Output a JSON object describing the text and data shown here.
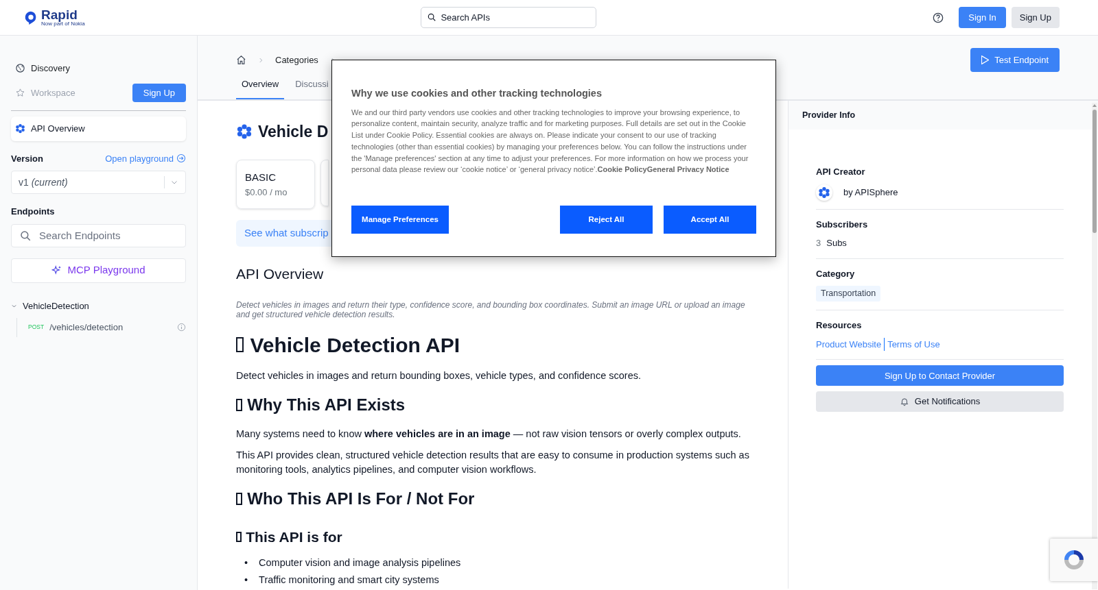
{
  "header": {
    "logo": "Rapid",
    "logo_tagline": "Now part of Nokia",
    "search": {
      "placeholder": "Search APIs"
    },
    "sign_in": "Sign In",
    "sign_up": "Sign Up"
  },
  "sidebar": {
    "nav": [
      {
        "label": "Discovery",
        "disabled": false
      },
      {
        "label": "Workspace",
        "disabled": true
      }
    ],
    "workspace_signup": "Sign Up",
    "api_overview": {
      "label": "API Overview",
      "selected": true
    },
    "version": {
      "label": "Version",
      "playground_link": "Open playground",
      "value": "v1",
      "note": "(current)"
    },
    "endpoints": {
      "label": "Endpoints",
      "search": {
        "placeholder": "Search Endpoints"
      },
      "mcp_button": "MCP Playground",
      "groups": [
        {
          "name": "VehicleDetection",
          "expanded": true,
          "children": [
            {
              "method": "POST",
              "path": "/vehicles/detection"
            }
          ]
        }
      ]
    }
  },
  "breadcrumb": [
    "Categories"
  ],
  "tabs": [
    {
      "label": "Overview",
      "selected": true
    },
    {
      "label": "Discussi",
      "selected": false
    }
  ],
  "test_endpoint": "Test Endpoint",
  "main": {
    "title": "Vehicle D",
    "plans": [
      {
        "name": "BASIC",
        "price": "$0.00 / mo"
      }
    ],
    "subscription_link": "See what subscrip",
    "overview_heading": "API Overview",
    "summary": "Detect vehicles in images and return their type, confidence score, and bounding box coordinates. Submit an image URL or upload an image and get structured vehicle detection results.",
    "blocks": [
      {
        "kind": "h1",
        "text": "Vehicle Detection API"
      },
      {
        "kind": "p",
        "text": "Detect vehicles in images and return bounding boxes, vehicle types, and confidence scores."
      },
      {
        "kind": "h2",
        "text": "Why This API Exists"
      },
      {
        "kind": "p",
        "text": "Many systems need to know **where vehicles are in an image** — not raw vision tensors or overly complex outputs."
      },
      {
        "kind": "p",
        "text": "This API provides clean, structured vehicle detection results that are easy to consume in production systems such as monitoring tools, analytics pipelines, and computer vision workflows."
      },
      {
        "kind": "h2",
        "text": "Who This API Is For / Not For"
      },
      {
        "kind": "h3",
        "text": "This API is for"
      },
      {
        "kind": "li",
        "bullet": "•",
        "text": "Computer vision and image analysis pipelines"
      },
      {
        "kind": "li",
        "bullet": "•",
        "text": "Traffic monitoring and smart city systems"
      }
    ]
  },
  "provider": {
    "title": "Provider Info",
    "creator_label": "API Creator",
    "creator": "by APISphere",
    "subscribers_label": "Subscribers",
    "subscribers_count": "3",
    "subscribers_unit": "Subs",
    "category_label": "Category",
    "category": "Transportation",
    "resources_label": "Resources",
    "resources": [
      "Product Website",
      "Terms of Use"
    ],
    "contact_button": "Sign Up to Contact Provider",
    "notify_button": "Get Notifications"
  },
  "cookie_dialog": {
    "title": "Why we use cookies and other tracking technologies",
    "body": "We and our third party vendors use cookies and other tracking technologies to improve your browsing experience, to personalize content, maintain security, analyze traffic and for marketing purposes. Full details are set out in the Cookie List under Cookie Policy. Essential cookies are always on. Please indicate your consent to our use of tracking technologies (other than essential cookies) by managing your preferences below. You can follow the instructions under the 'Manage preferences' section at any time to adjust your preferences. For more information on how we process your personal data please review our ‘cookie notice’ or ‘general privacy notice’.",
    "links": [
      "Cookie Policy",
      "General Privacy Notice"
    ],
    "manage": "Manage Preferences",
    "reject": "Reject All",
    "accept": "Accept All"
  }
}
